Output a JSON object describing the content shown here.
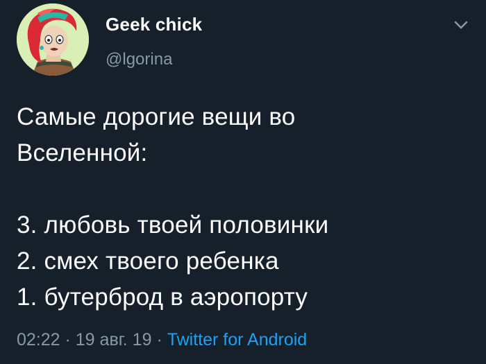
{
  "author": {
    "display_name": "Geek chick",
    "handle": "@lgorina",
    "avatar_icon": "cartoon-woman-red-hair-avatar"
  },
  "tweet": {
    "text": "Самые дорогие вещи во\nВселенной:\n\n3. любовь твоей половинки\n2. смех твоего ребенка\n1. бутерброд в аэропорту"
  },
  "meta": {
    "time": "02:22",
    "separator1": " · ",
    "date": "19 авг. 19",
    "separator2": " · ",
    "source": "Twitter for Android"
  },
  "colors": {
    "background": "#15202b",
    "secondary_text": "#8899a6",
    "link": "#1da1f2"
  }
}
